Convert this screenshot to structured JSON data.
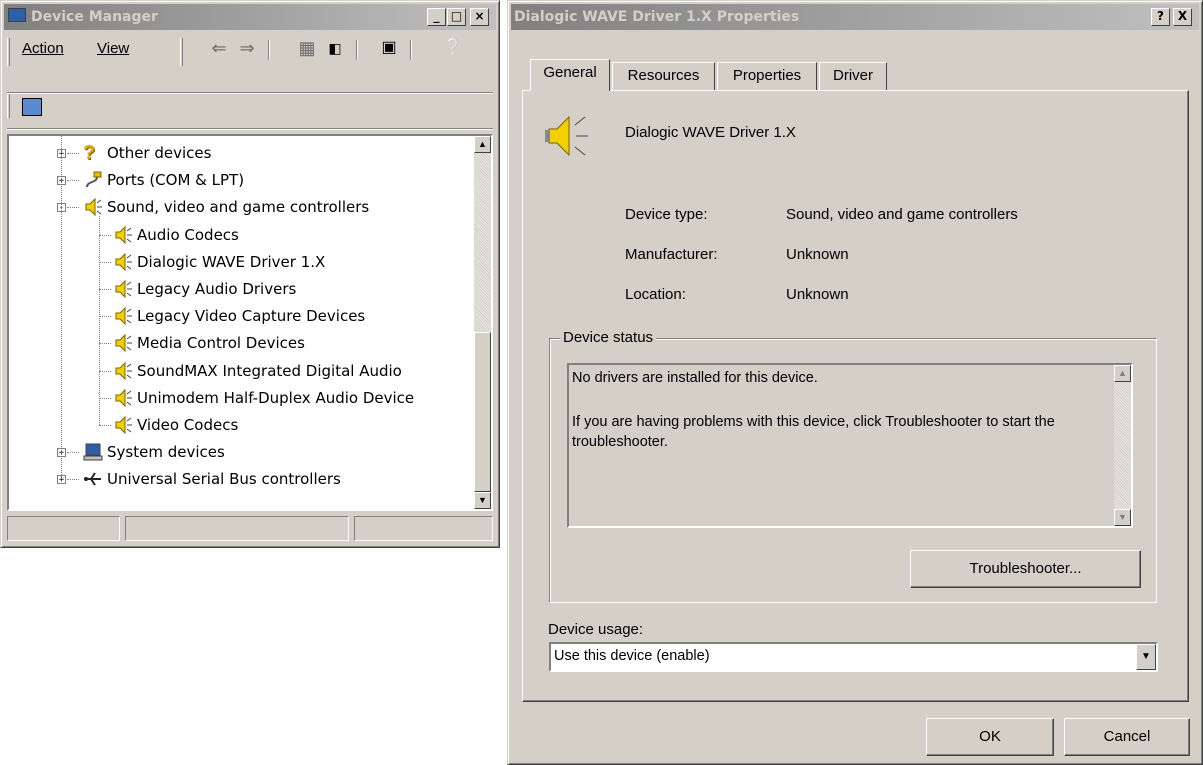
{
  "device_manager": {
    "title": "Device Manager",
    "menu": {
      "action": "Action",
      "view": "View"
    },
    "tree": [
      {
        "label": "Other devices",
        "icon": "question-icon",
        "expander": "+",
        "level": 1
      },
      {
        "label": "Ports (COM & LPT)",
        "icon": "port-icon",
        "expander": "+",
        "level": 1
      },
      {
        "label": "Sound, video and game controllers",
        "icon": "speaker-icon",
        "expander": "-",
        "level": 1
      },
      {
        "label": "Audio Codecs",
        "icon": "speaker-icon",
        "level": 2
      },
      {
        "label": "Dialogic WAVE Driver 1.X",
        "icon": "speaker-icon",
        "level": 2
      },
      {
        "label": "Legacy Audio Drivers",
        "icon": "speaker-icon",
        "level": 2
      },
      {
        "label": "Legacy Video Capture Devices",
        "icon": "speaker-icon",
        "level": 2
      },
      {
        "label": "Media Control Devices",
        "icon": "speaker-icon",
        "level": 2
      },
      {
        "label": "SoundMAX Integrated Digital Audio",
        "icon": "speaker-icon",
        "level": 2
      },
      {
        "label": "Unimodem Half-Duplex Audio Device",
        "icon": "speaker-icon",
        "level": 2
      },
      {
        "label": "Video Codecs",
        "icon": "speaker-icon",
        "level": 2
      },
      {
        "label": "System devices",
        "icon": "computer-icon",
        "expander": "+",
        "level": 1
      },
      {
        "label": "Universal Serial Bus controllers",
        "icon": "usb-icon",
        "expander": "+",
        "level": 1
      }
    ]
  },
  "properties": {
    "title": "Dialogic WAVE Driver 1.X Properties",
    "tabs": [
      "General",
      "Resources",
      "Properties",
      "Driver"
    ],
    "device_name": "Dialogic WAVE Driver 1.X",
    "device_type_label": "Device type:",
    "device_type_value": "Sound, video and game controllers",
    "manufacturer_label": "Manufacturer:",
    "manufacturer_value": "Unknown",
    "location_label": "Location:",
    "location_value": "Unknown",
    "status_group_label": "Device status",
    "status_line1": "No drivers are installed for this device.",
    "status_line2": "If you are having problems with this device, click Troubleshooter to start the troubleshooter.",
    "troubleshooter_button": "Troubleshooter...",
    "usage_label": "Device usage:",
    "usage_selected": "Use this device (enable)",
    "ok_button": "OK",
    "cancel_button": "Cancel",
    "help_button": "?",
    "close_button": "X"
  },
  "colors": {
    "titlebar_active": "#0a246a",
    "titlebar_inactive": "#808080",
    "face": "#d4d0c8"
  }
}
